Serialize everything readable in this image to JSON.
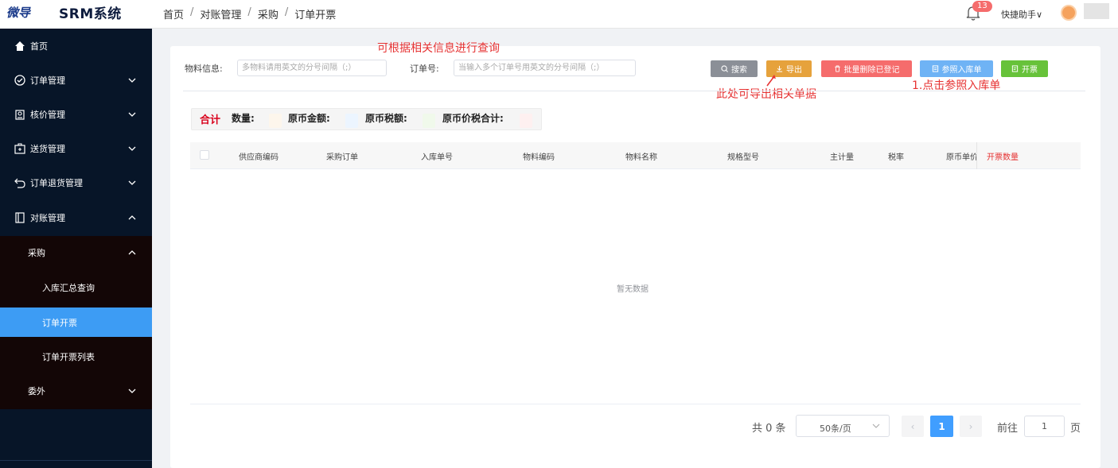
{
  "header": {
    "logo_mark": "微导",
    "app_title": "SRM系统",
    "breadcrumb": [
      "首页",
      "对账管理",
      "采购",
      "订单开票"
    ],
    "notification_count": "13",
    "quick_helper": "快捷助手"
  },
  "sidebar": {
    "items": [
      {
        "label": "首页",
        "icon": "home-icon"
      },
      {
        "label": "订单管理",
        "icon": "check-circle-icon"
      },
      {
        "label": "核价管理",
        "icon": "price-tag-icon"
      },
      {
        "label": "送货管理",
        "icon": "package-icon"
      },
      {
        "label": "订单退货管理",
        "icon": "return-arrow-icon"
      },
      {
        "label": "对账管理",
        "icon": "ledger-icon"
      }
    ],
    "submenu": {
      "group": "采购",
      "items": [
        "入库汇总查询",
        "订单开票",
        "订单开票列表"
      ],
      "active": "订单开票",
      "next_group": "委外"
    }
  },
  "search": {
    "hint": "可根据相关信息进行查询",
    "material_label": "物料信息:",
    "material_placeholder": "多物料请用英文的分号间隔（;）",
    "order_label": "订单号:",
    "order_placeholder": "当输入多个订单号用英文的分号间隔（;）"
  },
  "toolbar": {
    "search": "搜索",
    "export": "导出",
    "batch_delete": "批量删除已登记",
    "reference_inbound": "参照入库单",
    "invoice": "开票",
    "export_hint": "此处可导出相关单据",
    "reference_hint": "1.点击参照入库单"
  },
  "summary": {
    "total": "合计",
    "qty": "数量:",
    "orig_amount": "原币金额:",
    "orig_tax": "原币税额:",
    "orig_total": "原币价税合计:"
  },
  "table": {
    "columns": [
      "供应商编码",
      "采购订单",
      "入库单号",
      "物料编码",
      "物料名称",
      "规格型号",
      "主计量",
      "税率",
      "原币单价",
      "开票数量"
    ],
    "empty_text": "暂无数据"
  },
  "pagination": {
    "total": "共 0 条",
    "page_size": "50条/页",
    "current": "1",
    "goto_label": "前往",
    "goto_value": "1",
    "page_unit": "页",
    "prev": "‹",
    "next": "›"
  },
  "colors": {
    "sidebar_bg": "#071528",
    "submenu_bg": "#130606",
    "active_item": "#3d9cf4",
    "btn_search": "#8b8f97",
    "btn_export": "#e6a23c",
    "btn_delete": "#f56c6c",
    "btn_reference": "#6fb3f5",
    "btn_invoice": "#67c23a",
    "hint_red": "#e63333"
  }
}
